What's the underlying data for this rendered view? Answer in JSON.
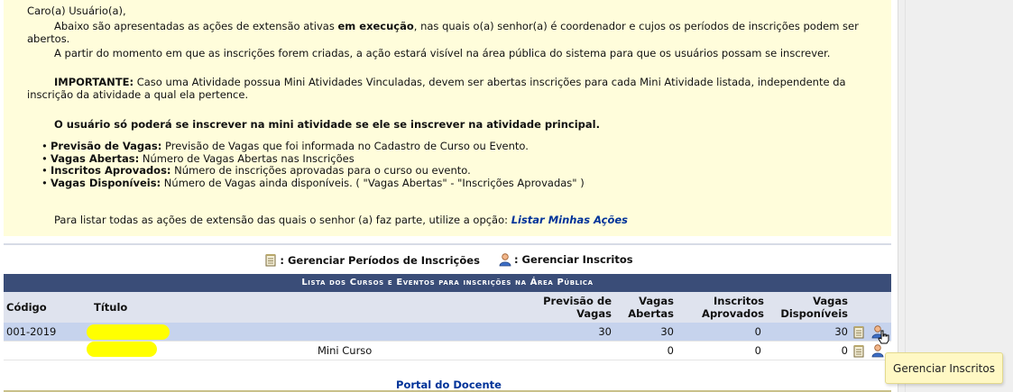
{
  "info": {
    "greeting": "Caro(a) Usuário(a),",
    "p1a": "Abaixo são apresentadas as ações de extensão ativas ",
    "p1b": "em execução",
    "p1c": ", nas quais o(a) senhor(a) é coordenador e cujos os períodos de inscrições podem ser",
    "p1d": "abertos.",
    "p2": "A partir do momento em que as inscrições forem criadas, a ação estará visível na área pública do sistema para que os usuários possam se inscrever.",
    "imp_label": "IMPORTANTE:",
    "imp_text": " Caso uma Atividade possua Mini Atividades Vinculadas, devem ser abertas inscrições para cada Mini Atividade listada, independente da",
    "imp_text2": "inscrição da atividade a qual ela pertence.",
    "bold_note": "O usuário só poderá se inscrever na mini atividade se ele se inscrever na atividade principal.",
    "bullets": [
      {
        "term": "Previsão de Vagas:",
        "desc": " Previsão de Vagas que foi informada no Cadastro de Curso ou Evento."
      },
      {
        "term": "Vagas Abertas:",
        "desc": " Número de Vagas Abertas nas Inscrições"
      },
      {
        "term": "Inscritos Aprovados:",
        "desc": " Número de inscrições aprovadas para o curso ou evento."
      },
      {
        "term": "Vagas Disponíveis:",
        "desc": " Número de Vagas ainda disponíveis. ( \"Vagas Abertas\" - \"Inscrições Aprovadas\" )"
      }
    ],
    "list_prompt": "Para listar todas as ações de extensão das quais o senhor (a) faz parte, utilize a opção: ",
    "list_link": "Listar Minhas Ações"
  },
  "legend": {
    "periods": ": Gerenciar Períodos de Inscrições",
    "inscritos": ": Gerenciar Inscritos"
  },
  "table": {
    "caption": "Lista dos Cursos e Eventos para inscrições na Área Pública",
    "headers": {
      "codigo": "Código",
      "titulo": "Título",
      "previsao1": "Previsão de",
      "previsao2": "Vagas",
      "abertas1": "Vagas",
      "abertas2": "Abertas",
      "inscritos1": "Inscritos",
      "inscritos2": "Aprovados",
      "disp1": "Vagas",
      "disp2": "Disponíveis"
    },
    "rows": [
      {
        "codigo": "001-2019",
        "titulo": "",
        "previsao": "30",
        "abertas": "30",
        "aprovados": "0",
        "disponiveis": "30"
      },
      {
        "codigo": "",
        "titulo": "Mini Curso",
        "previsao": "",
        "abertas": "0",
        "aprovados": "0",
        "disponiveis": "0"
      }
    ]
  },
  "footer": {
    "portal": "Portal do Docente"
  },
  "tooltip": {
    "text": "Gerenciar Inscritos"
  }
}
